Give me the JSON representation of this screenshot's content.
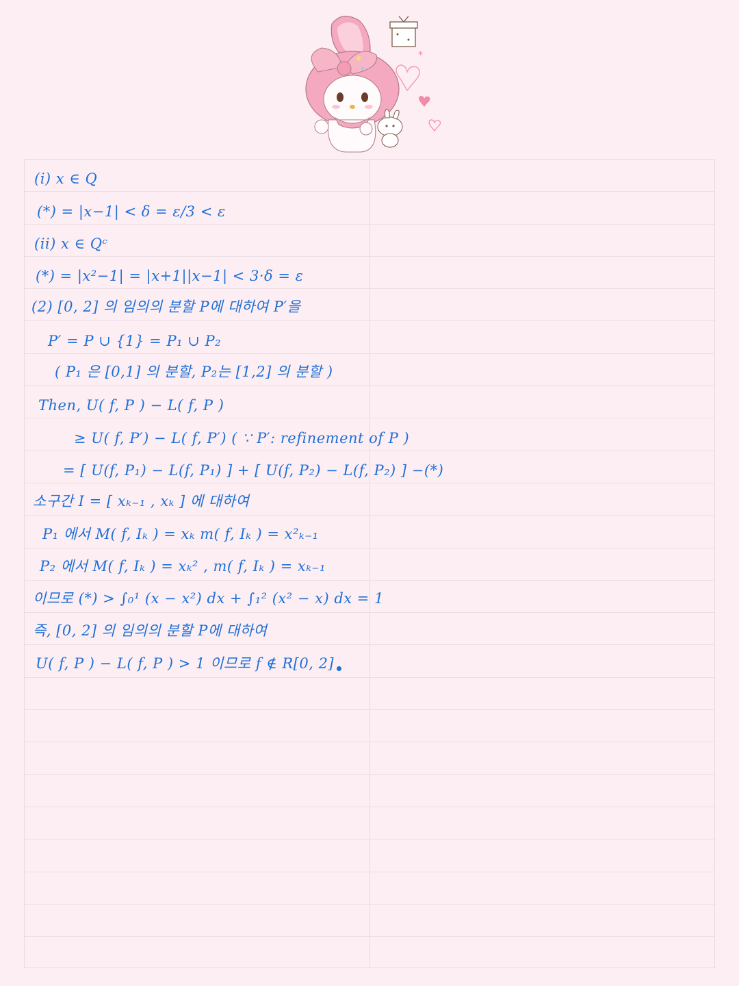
{
  "notes": {
    "lines": [
      "(i)  x ∈ Q",
      "(*) = |x−1| < δ = ε/3 < ε",
      "(ii)  x ∈ Qᶜ",
      "(*) = |x²−1| = |x+1||x−1| < 3·δ = ε",
      "(2)  [0, 2] 의 임의의 분할 P에 대하여  P′을",
      "P′ = P ∪ {1} = P₁ ∪ P₂",
      "( P₁ 은 [0,1] 의 분할,  P₂는 [1,2] 의 분할 )",
      "Then,   U( f, P ) − L( f, P )",
      "≥ U( f, P′) − L( f, P′)  ( ∵ P′: refinement of P )",
      "= [ U(f, P₁) − L(f, P₁) ] + [ U(f, P₂) − L(f, P₂) ]  −(*)",
      "소구간  I = [ xₖ₋₁ , xₖ ] 에 대하여",
      "P₁ 에서   M( f, Iₖ ) = xₖ     m( f, Iₖ ) = x²ₖ₋₁",
      "P₂ 에서   M( f, Iₖ ) = xₖ² ,  m( f, Iₖ ) = xₖ₋₁",
      "이므로  (*) > ∫₀¹ (x − x²) dx + ∫₁² (x² − x) dx = 1",
      "즉,  [0, 2] 의 임의의 분할  P에 대하여",
      "U( f, P ) − L( f, P ) > 1  이므로   f ∉ R[0, 2]"
    ]
  },
  "sticker": {
    "icon": "pink-bunny-character-with-hearts-and-gift-icon"
  }
}
